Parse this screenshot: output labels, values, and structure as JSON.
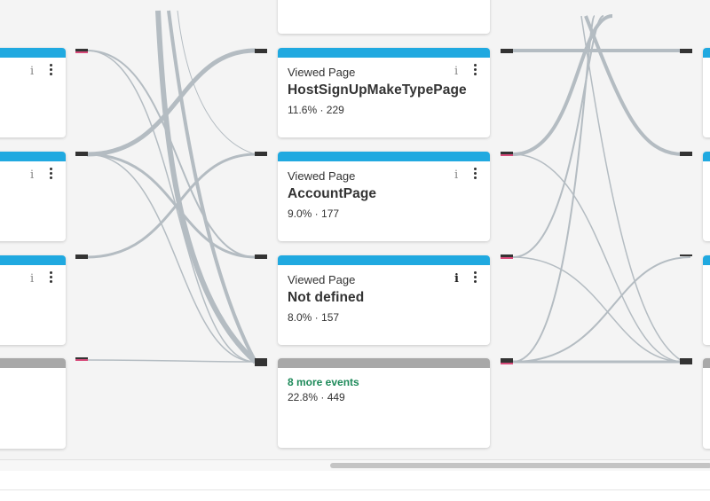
{
  "cards": {
    "hostsignup": {
      "label": "Viewed Page",
      "title": "HostSignUpMakeTypePage",
      "stats": "11.6% · 229"
    },
    "account": {
      "label": "Viewed Page",
      "title": "AccountPage",
      "stats": "9.0% · 177"
    },
    "notdefined": {
      "label": "Viewed Page",
      "title": "Not defined",
      "stats": "8.0% · 157"
    },
    "more": {
      "label": "8 more events",
      "stats": "22.8% · 449"
    }
  },
  "icons": {
    "info": "i",
    "more": "kebab-menu-icon"
  },
  "colors": {
    "accent": "#20a9e0",
    "more_bar": "#a8a8a8",
    "more_text": "#1e8a5a",
    "flow": "#b4bcc2",
    "handle_highlight": "#d84a7a"
  }
}
